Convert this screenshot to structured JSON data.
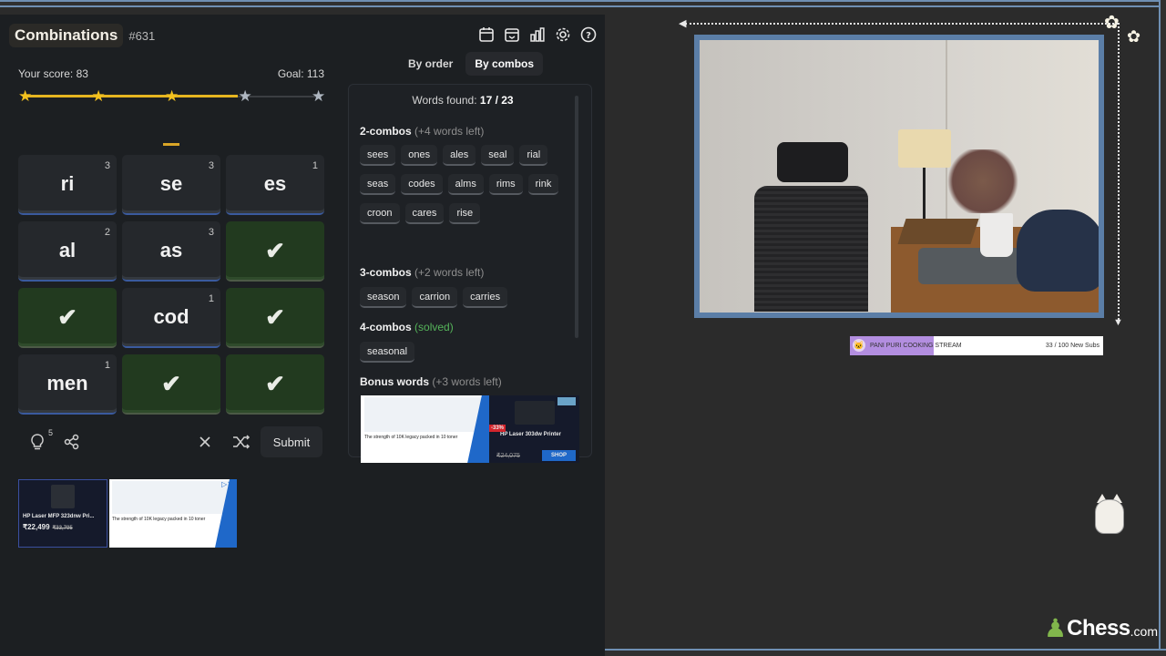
{
  "game": {
    "title": "Combinations",
    "puzzle_number": "#631",
    "score_label": "Your score: 83",
    "goal_label": "Goal: 113",
    "progress": {
      "score": 83,
      "goal": 113,
      "stars_total": 5,
      "stars_earned": 3
    },
    "tiles": [
      {
        "text": "ri",
        "count": "3",
        "solved": false
      },
      {
        "text": "se",
        "count": "3",
        "solved": false
      },
      {
        "text": "es",
        "count": "1",
        "solved": false
      },
      {
        "text": "al",
        "count": "2",
        "solved": false
      },
      {
        "text": "as",
        "count": "3",
        "solved": false
      },
      {
        "text": "",
        "count": "",
        "solved": true
      },
      {
        "text": "",
        "count": "",
        "solved": true
      },
      {
        "text": "cod",
        "count": "1",
        "solved": false
      },
      {
        "text": "",
        "count": "",
        "solved": true
      },
      {
        "text": "men",
        "count": "1",
        "solved": false
      },
      {
        "text": "",
        "count": "",
        "solved": true
      },
      {
        "text": "",
        "count": "",
        "solved": true
      }
    ],
    "actions": {
      "hint_count": "5",
      "submit": "Submit"
    }
  },
  "icons": {
    "calendar": "calendar-icon",
    "calendar_archive": "calendar-archive-icon",
    "stats": "bar-chart-icon",
    "settings": "gear-icon",
    "help": "help-icon"
  },
  "words": {
    "tabs": [
      "By order",
      "By combos"
    ],
    "active_tab": "By combos",
    "found_prefix": "Words found:",
    "found_value": "17 / 23",
    "groups": [
      {
        "title": "2-combos",
        "note": "(+4 words left)",
        "words": [
          "sees",
          "ones",
          "ales",
          "seal",
          "rial",
          "seas",
          "codes",
          "alms",
          "rims",
          "rink",
          "croon",
          "cares",
          "rise"
        ]
      },
      {
        "title": "3-combos",
        "note": "(+2 words left)",
        "words": [
          "season",
          "carrion",
          "carries"
        ]
      },
      {
        "title": "4-combos",
        "note": "(solved)",
        "words": [
          "seasonal"
        ]
      },
      {
        "title": "Bonus words",
        "note": "(+3 words left)",
        "words": []
      }
    ]
  },
  "ads": {
    "small_printer_name": "HP Laser MFP 323dnw Pri...",
    "small_printer_price": "₹22,499",
    "small_printer_old": "₹33,705",
    "banner_text": "The strength of 10K legacy packed in 10 toner",
    "big_printer_name": "HP Laser 303dw Printer",
    "big_printer_old": "₹24,075",
    "big_printer_discount": "-33%",
    "shop": "SHOP",
    "adchoice": "▷✕"
  },
  "stream": {
    "subbar_label": "PANI PURI COOKING STREAM",
    "subbar_goal": "33 / 100 New Subs",
    "subs_current": 33,
    "subs_goal": 100,
    "brand_word": "Chess",
    "brand_domain": ".com",
    "accent": "#81b64c"
  }
}
